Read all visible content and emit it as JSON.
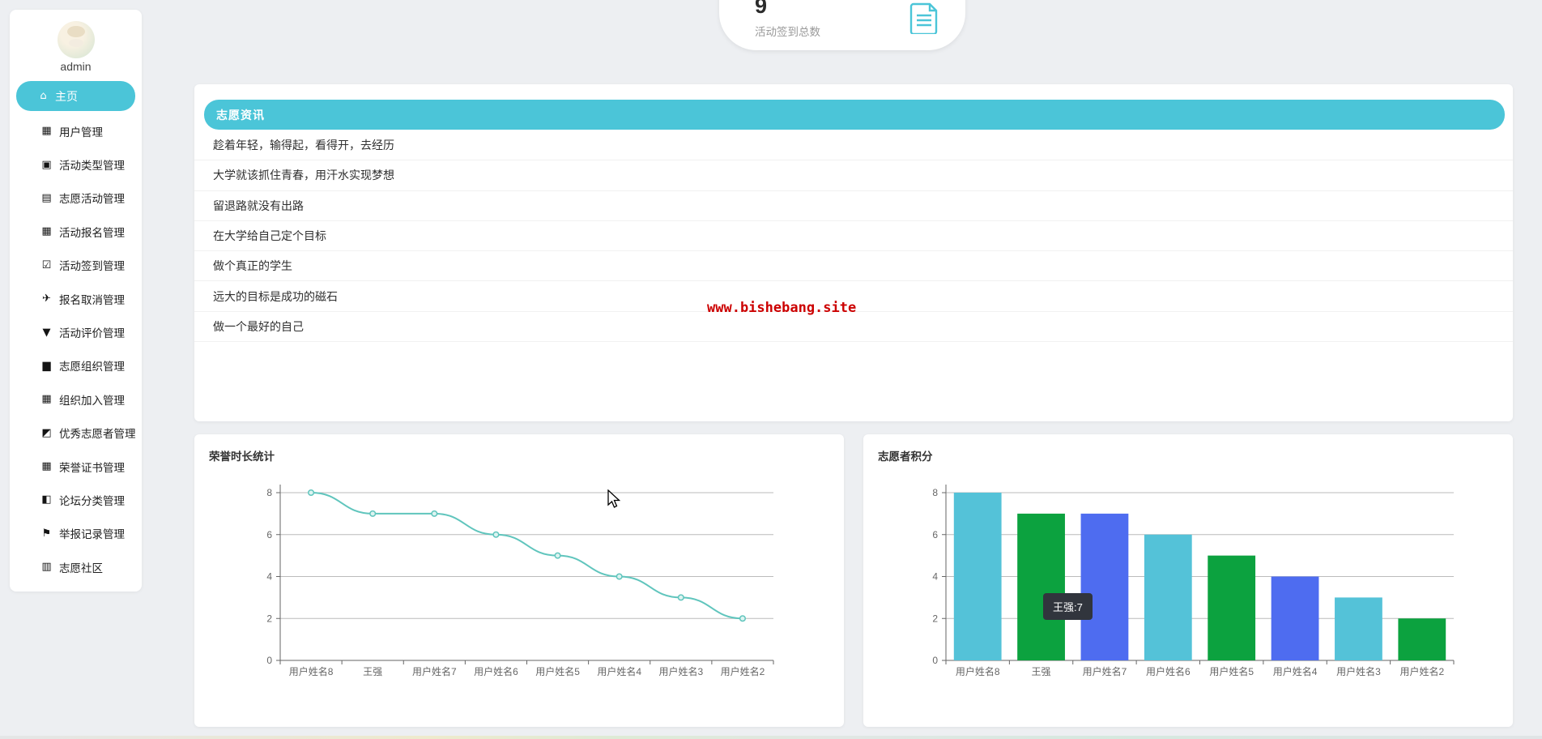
{
  "user": {
    "name": "admin"
  },
  "sidebar": {
    "active_item": {
      "label": "主页",
      "icon": "home-icon"
    },
    "items": [
      {
        "label": "用户管理",
        "icon": "grid-icon"
      },
      {
        "label": "活动类型管理",
        "icon": "comment-icon"
      },
      {
        "label": "志愿活动管理",
        "icon": "briefcase-icon"
      },
      {
        "label": "活动报名管理",
        "icon": "grid-icon"
      },
      {
        "label": "活动签到管理",
        "icon": "clipboard-check-icon"
      },
      {
        "label": "报名取消管理",
        "icon": "paper-plane-icon"
      },
      {
        "label": "活动评价管理",
        "icon": "filter-icon"
      },
      {
        "label": "志愿组织管理",
        "icon": "bar-chart-icon"
      },
      {
        "label": "组织加入管理",
        "icon": "grid-icon"
      },
      {
        "label": "优秀志愿者管理",
        "icon": "trend-chart-icon"
      },
      {
        "label": "荣誉证书管理",
        "icon": "grid-icon"
      },
      {
        "label": "论坛分类管理",
        "icon": "thumbs-up-icon"
      },
      {
        "label": "举报记录管理",
        "icon": "flag-icon"
      },
      {
        "label": "志愿社区",
        "icon": "clipboard-icon"
      }
    ]
  },
  "icon_glyphs": {
    "home-icon": "⌂",
    "grid-icon": "▦",
    "comment-icon": "▣",
    "briefcase-icon": "▤",
    "clipboard-check-icon": "☑",
    "paper-plane-icon": "✈",
    "filter-icon": "▼",
    "bar-chart-icon": "▆",
    "trend-chart-icon": "◩",
    "thumbs-up-icon": "◧",
    "flag-icon": "⚑",
    "clipboard-icon": "▥"
  },
  "stat_card": {
    "value": "9",
    "label": "活动签到总数",
    "icon": "document-icon"
  },
  "news_panel": {
    "title": "志愿资讯",
    "items": [
      "趁着年轻，输得起，看得开，去经历",
      "大学就该抓住青春，用汗水实现梦想",
      "留退路就没有出路",
      "在大学给自己定个目标",
      "做个真正的学生",
      "远大的目标是成功的磁石",
      "做一个最好的自己"
    ]
  },
  "watermark": {
    "text": "www.bishebang.site",
    "color": "#cc0000"
  },
  "colors": {
    "accent_teal": "#4bc5d8",
    "line_series": "#60c5bd",
    "bar_cycle": [
      "#54c2d8",
      "#0ca23f",
      "#4e6cf0"
    ],
    "axis": "#666666",
    "gridline": "#bbbbbb",
    "tick_label": "#666666",
    "tooltip_bg": "#31353d"
  },
  "chart_data": [
    {
      "type": "line",
      "title": "荣誉时长统计",
      "categories": [
        "用户姓名8",
        "王强",
        "用户姓名7",
        "用户姓名6",
        "用户姓名5",
        "用户姓名4",
        "用户姓名3",
        "用户姓名2"
      ],
      "values": [
        8,
        7,
        7,
        6,
        5,
        4,
        3,
        2
      ],
      "xlabel": "",
      "ylabel": "",
      "ylim": [
        0,
        8
      ],
      "yticks": [
        0,
        2,
        4,
        6,
        8
      ],
      "grid": true,
      "smooth": true,
      "legend": "none"
    },
    {
      "type": "bar",
      "title": "志愿者积分",
      "categories": [
        "用户姓名8",
        "王强",
        "用户姓名7",
        "用户姓名6",
        "用户姓名5",
        "用户姓名4",
        "用户姓名3",
        "用户姓名2"
      ],
      "values": [
        8,
        7,
        7,
        6,
        5,
        4,
        3,
        2
      ],
      "xlabel": "",
      "ylabel": "",
      "ylim": [
        0,
        8
      ],
      "yticks": [
        0,
        2,
        4,
        6,
        8
      ],
      "grid": true,
      "legend": "none",
      "tooltip": {
        "text": "王强:7"
      }
    }
  ]
}
